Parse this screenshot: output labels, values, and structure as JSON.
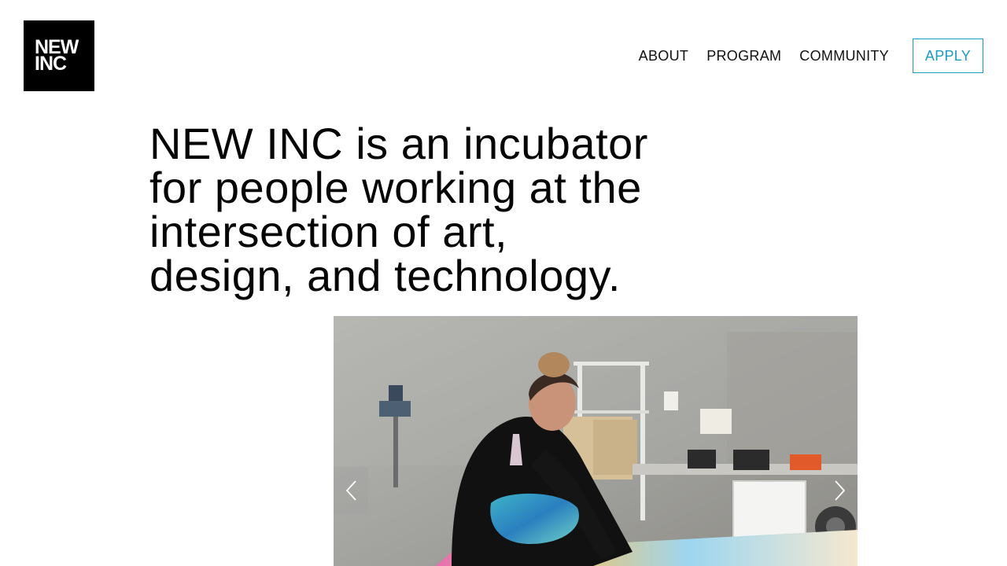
{
  "header": {
    "logo": {
      "line1": "NEW",
      "line2": "INC"
    },
    "nav": [
      {
        "label": "ABOUT"
      },
      {
        "label": "PROGRAM"
      },
      {
        "label": "COMMUNITY"
      }
    ],
    "apply_label": "APPLY"
  },
  "hero": {
    "lines": [
      "NEW INC is an incubator",
      "for people working at the",
      "intersection of art,",
      "design, and technology."
    ]
  },
  "carousel": {
    "prev_icon": "chevron-left-icon",
    "next_icon": "chevron-right-icon"
  },
  "colors": {
    "accent": "#1a9bc4",
    "logo_bg": "#000000",
    "text": "#050505"
  }
}
